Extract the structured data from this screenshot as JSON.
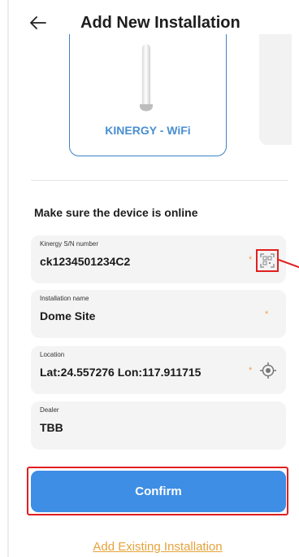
{
  "header": {
    "title": "Add New Installation",
    "back_icon": "arrow-left-icon"
  },
  "device_card": {
    "label": "KINERGY - WiFi"
  },
  "section": {
    "heading": "Make sure the device is online"
  },
  "fields": {
    "serial": {
      "label": "Kinergy S/N number",
      "value": "ck1234501234C2",
      "required_mark": "*",
      "action_icon": "qr-scan-icon"
    },
    "name": {
      "label": "Installation name",
      "value": "Dome Site",
      "required_mark": "*"
    },
    "location": {
      "label": "Location",
      "value": "Lat:24.557276 Lon:117.911715",
      "required_mark": "*",
      "action_icon": "locate-icon"
    },
    "dealer": {
      "label": "Dealer",
      "value": "TBB"
    }
  },
  "actions": {
    "confirm_label": "Confirm",
    "add_existing_label": "Add Existing Installation"
  },
  "colors": {
    "accent": "#3d8ee4",
    "link": "#e5a33b",
    "highlight": "#e02020",
    "field_bg": "#f4f4f4"
  }
}
